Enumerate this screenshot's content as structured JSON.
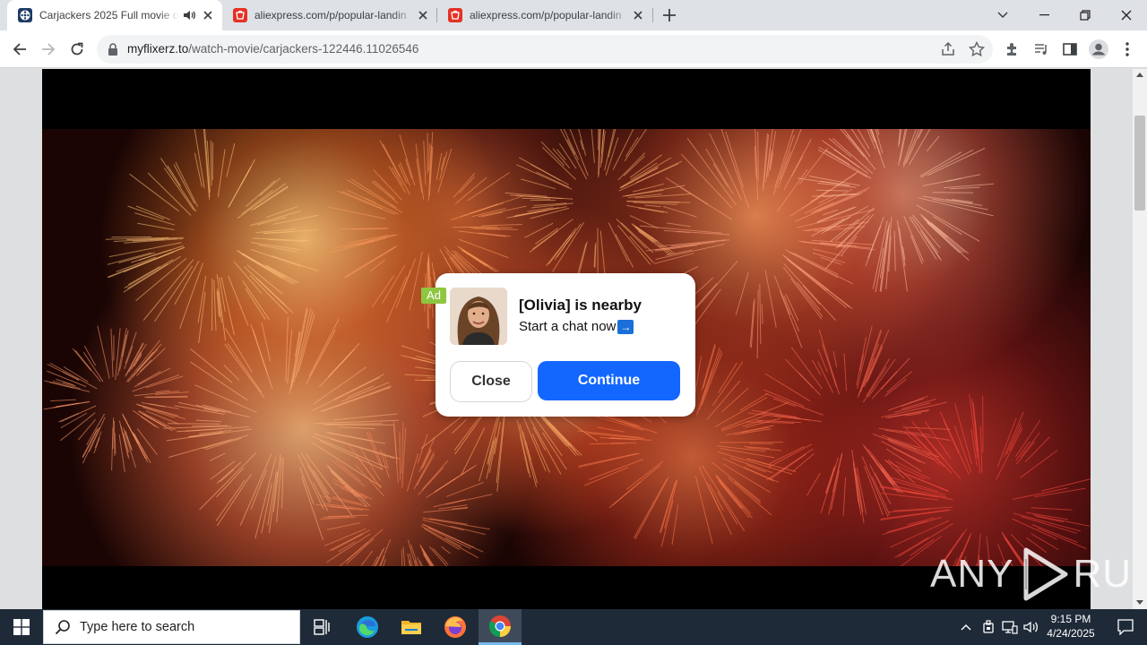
{
  "browser": {
    "tabs": [
      {
        "title": "Carjackers 2025 Full movie o",
        "active": true,
        "audio": true
      },
      {
        "title": "aliexpress.com/p/popular-landin",
        "active": false,
        "audio": false
      },
      {
        "title": "aliexpress.com/p/popular-landin",
        "active": false,
        "audio": false
      }
    ],
    "address": {
      "host": "myflixerz.to",
      "path": "/watch-movie/carjackers-122446.11026546"
    }
  },
  "ad": {
    "badge": "Ad",
    "title": "[Olivia] is nearby",
    "subtitle": "Start a chat now",
    "arrow": "→",
    "close_label": "Close",
    "continue_label": "Continue",
    "accent_color": "#1367ff",
    "badge_color": "#8fc640"
  },
  "watermark": {
    "left": "ANY",
    "right": "RUN"
  },
  "taskbar": {
    "search_placeholder": "Type here to search",
    "time": "9:15 PM",
    "date": "4/24/2025",
    "apps": [
      "task-view-icon",
      "edge-icon",
      "file-explorer-icon",
      "firefox-icon",
      "chrome-icon"
    ]
  }
}
